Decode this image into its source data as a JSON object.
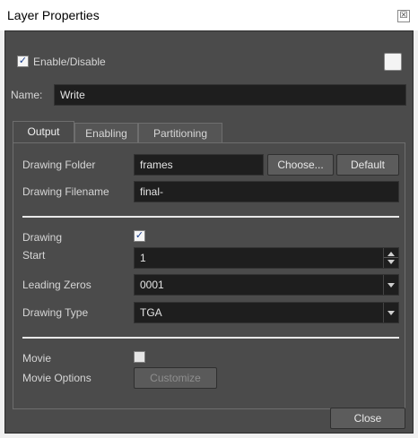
{
  "window": {
    "title": "Layer Properties",
    "close_glyph": "☒"
  },
  "enable": {
    "label": "Enable/Disable",
    "checked": true,
    "color_swatch": "#f4f4f4"
  },
  "name": {
    "label": "Name:",
    "value": "Write"
  },
  "tabs": [
    {
      "label": "Output",
      "active": true
    },
    {
      "label": "Enabling",
      "active": false
    },
    {
      "label": "Partitioning",
      "active": false
    }
  ],
  "output": {
    "drawing_folder": {
      "label": "Drawing Folder",
      "value": "frames",
      "choose_label": "Choose...",
      "default_label": "Default"
    },
    "drawing_filename": {
      "label": "Drawing Filename",
      "value": "final-"
    },
    "drawing": {
      "label": "Drawing",
      "checked": true
    },
    "start": {
      "label": "Start",
      "value": "1"
    },
    "leading_zeros": {
      "label": "Leading Zeros",
      "value": "0001"
    },
    "drawing_type": {
      "label": "Drawing Type",
      "value": "TGA"
    },
    "movie": {
      "label": "Movie",
      "checked": false
    },
    "movie_options": {
      "label": "Movie Options",
      "customize_label": "Customize"
    }
  },
  "footer": {
    "close_label": "Close"
  },
  "icons": {
    "check": "✓",
    "spin_up": "spin-up-icon",
    "spin_down": "spin-down-icon",
    "dropdown": "chevron-down-icon"
  }
}
